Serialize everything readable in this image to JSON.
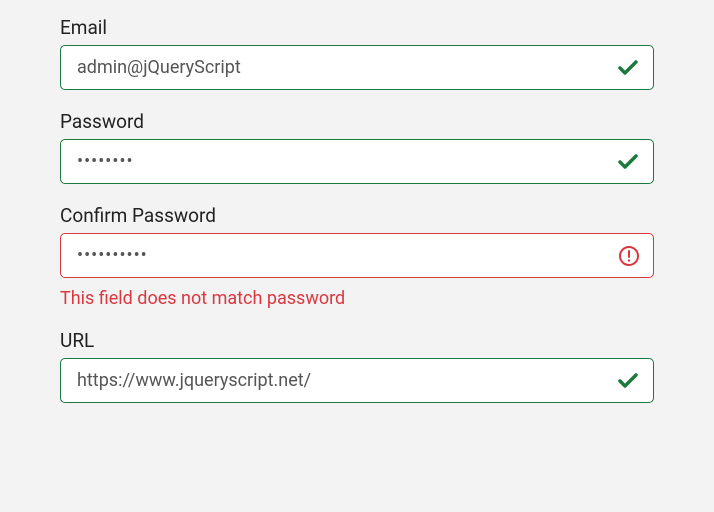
{
  "fields": {
    "email": {
      "label": "Email",
      "value": "admin@jQueryScript",
      "status": "valid"
    },
    "password": {
      "label": "Password",
      "value": "••••••••",
      "status": "valid"
    },
    "confirm_password": {
      "label": "Confirm Password",
      "value": "••••••••••",
      "status": "error",
      "error_message": "This field does not match password"
    },
    "url": {
      "label": "URL",
      "value": "https://www.jqueryscript.net/",
      "status": "valid"
    }
  }
}
